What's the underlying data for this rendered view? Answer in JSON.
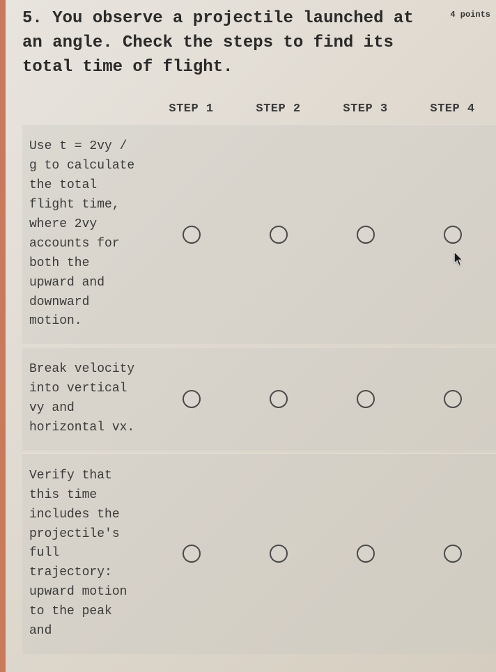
{
  "question": {
    "number": "5.",
    "text": "5. You observe a projectile launched at an angle. Check the steps to find its total time of flight.",
    "points": "4 points"
  },
  "columns": [
    "STEP 1",
    "STEP 2",
    "STEP 3",
    "STEP 4"
  ],
  "rows": [
    {
      "label": "Use t = 2vy / g to calculate the total flight time, where 2vy accounts for both the upward and downward motion.",
      "has_cursor": true
    },
    {
      "label": "Break velocity into vertical vy and horizontal vx.",
      "has_cursor": false
    },
    {
      "label": "Verify that this time includes the projectile's full trajectory: upward motion to the peak and",
      "has_cursor": false
    }
  ]
}
